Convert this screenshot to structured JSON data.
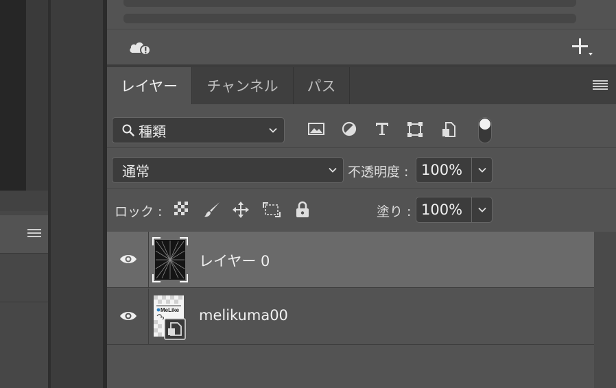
{
  "tabs": [
    {
      "label": "レイヤー",
      "active": true
    },
    {
      "label": "チャンネル",
      "active": false
    },
    {
      "label": "パス",
      "active": false
    }
  ],
  "filter": {
    "value": "種類"
  },
  "blend": {
    "mode": "通常",
    "opacity_label": "不透明度 :",
    "opacity": "100%"
  },
  "lock": {
    "label": "ロック :",
    "fill_label": "塗り :",
    "fill": "100%"
  },
  "layers": [
    {
      "name": "レイヤー 0",
      "visible": true,
      "selected": true
    },
    {
      "name": "melikuma00",
      "visible": true,
      "selected": false,
      "thumb_text": "MeLike"
    }
  ],
  "colors": {
    "panel_bg": "#535353",
    "selected_row": "#6a6a6a",
    "tab_bar": "#3f3f3f",
    "field_bg": "#3c3c3c",
    "accent_blue": "#2a7fc1"
  }
}
